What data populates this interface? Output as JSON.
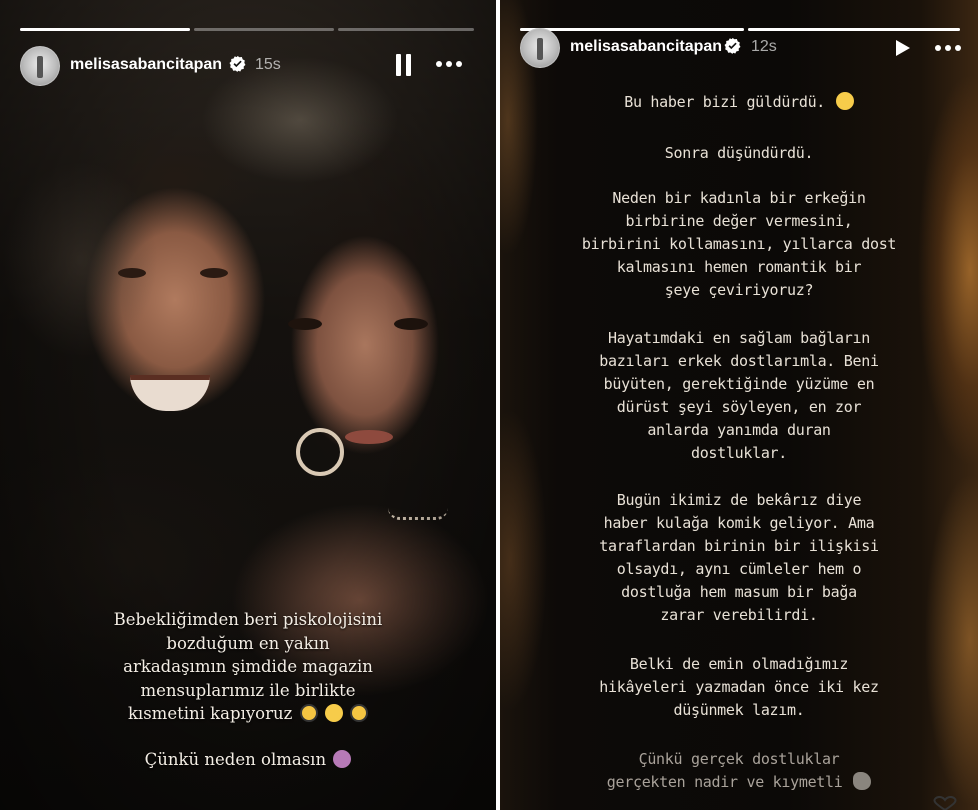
{
  "left_story": {
    "username": "melisasabancitapan",
    "verified": true,
    "timestamp": "15s",
    "progress": [
      1.0,
      0.0,
      0.0
    ],
    "controls": {
      "pause_icon": "pause-icon",
      "more_icon": "more-horizontal-icon"
    },
    "caption_lines": [
      "Bebekliğimden beri piskolojisini",
      "bozduğum en yakın",
      "arkadaşımın şimdide magazin",
      "mensuplarımız ile birlikte",
      "kısmetini kapıyoruz"
    ],
    "caption_emojis": [
      "nerd-face-icon",
      "grinning-face-icon",
      "nerd-face-icon"
    ],
    "caption_2": "Çünkü neden olmasın",
    "caption_2_emoji": "woman-shrugging-icon"
  },
  "right_story": {
    "username": "melisasabancitapan",
    "verified": true,
    "timestamp": "12s",
    "progress": [
      1.0,
      1.0
    ],
    "controls": {
      "play_icon": "play-icon",
      "more_icon": "more-horizontal-icon"
    },
    "paragraphs": [
      {
        "lines": [
          "Bu haber bizi güldürdü."
        ],
        "emoji": "grinning-face-icon"
      },
      {
        "lines": [
          "Sonra düşündürdü."
        ]
      },
      {
        "lines": [
          "Neden bir kadınla bir erkeğin",
          "birbirine değer vermesini,",
          "birbirini kollamasını, yıllarca dost",
          "kalmasını hemen romantik bir",
          "şeye çeviriyoruz?"
        ]
      },
      {
        "lines": [
          "Hayatımdaki en sağlam bağların",
          "bazıları erkek dostlarımla. Beni",
          "büyüten, gerektiğinde yüzüme en",
          "dürüst şeyi söyleyen, en zor",
          "anlarda yanımda duran",
          "dostluklar."
        ]
      },
      {
        "lines": [
          "Bugün ikimiz de bekârız diye",
          "haber kulağa komik geliyor. Ama",
          "taraflardan birinin bir ilişkisi",
          "olsaydı, aynı cümleler hem o",
          "dostluğa hem masum bir bağa",
          "zarar verebilirdi."
        ]
      },
      {
        "lines": [
          "Belki de emin olmadığımız",
          "hikâyeleri yazmadan önce iki kez",
          "düşünmek lazım."
        ]
      },
      {
        "lines": [
          "Çünkü gerçek dostluklar",
          "gerçekten nadir ve kıymetli"
        ],
        "emoji": "dove-icon"
      }
    ],
    "like_icon": "heart-icon"
  }
}
